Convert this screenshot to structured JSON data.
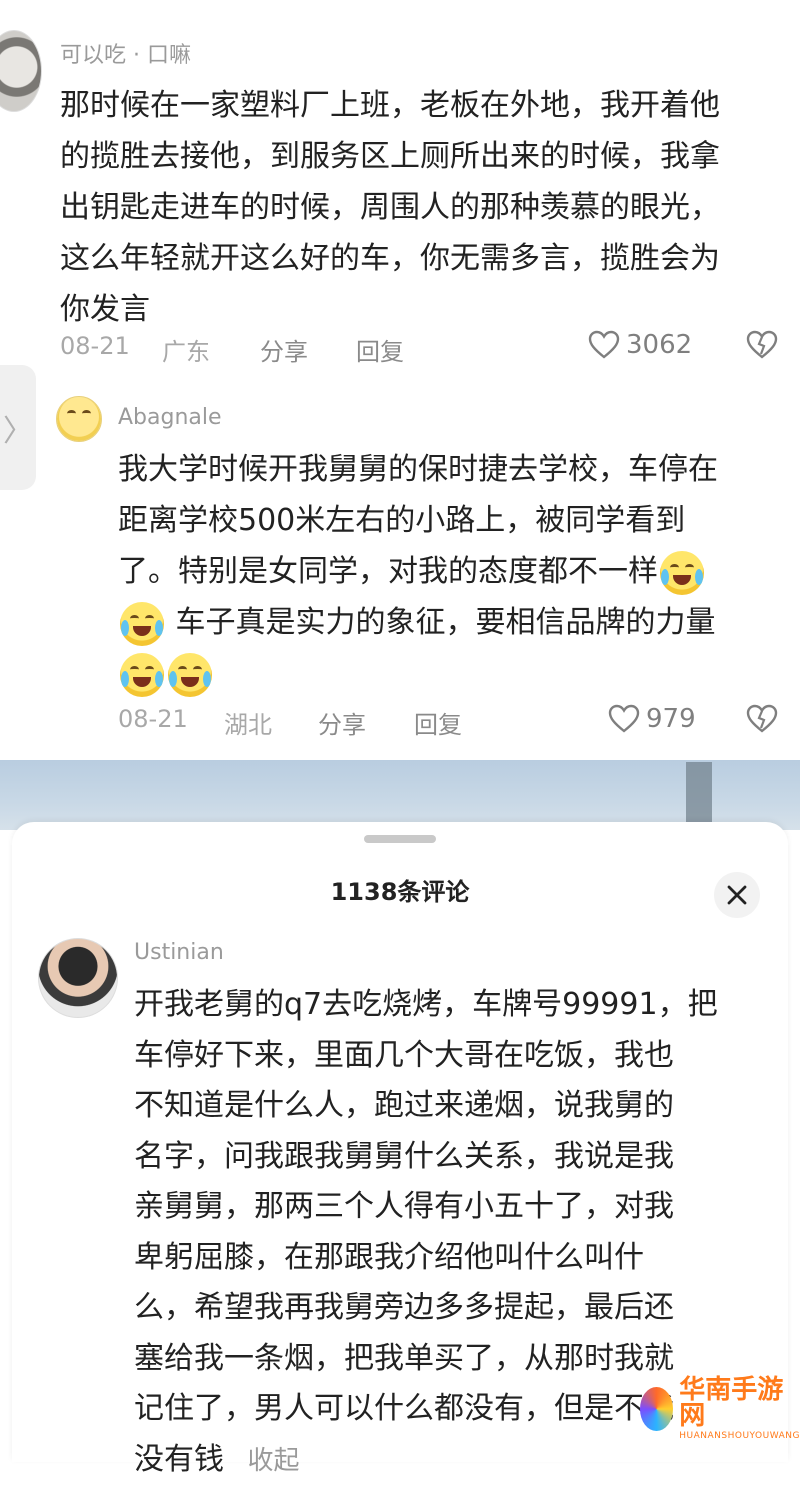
{
  "comments": [
    {
      "username": "可以吃 · 口嘛",
      "text_lines": [
        "那时候在一家塑料厂上班，老板在外地，我开着他",
        "的揽胜去接他，到服务区上厕所出来的时候，我拿",
        "出钥匙走进车的时候，周围人的那种羡慕的眼光，",
        "这么年轻就开这么好的车，你无需多言，揽胜会为",
        "你发言"
      ],
      "date": "08-21",
      "location": "广东",
      "share_label": "分享",
      "reply_label": "回复",
      "likes": "3062"
    },
    {
      "username": "Abagnale",
      "text_lines": [
        "我大学时候开我舅舅的保时捷去学校，车停在",
        "距离学校500米左右的小路上，被同学看到",
        "了。特别是女同学，对我的态度都不一样",
        "车子真是实力的象征，要相信品牌的力量"
      ],
      "date": "08-21",
      "location": "湖北",
      "share_label": "分享",
      "reply_label": "回复",
      "likes": "979"
    }
  ],
  "side_tab": {
    "icon": "chevron-right-icon",
    "glyph": "〉"
  },
  "sheet": {
    "title": "1138条评论",
    "close_icon": "close-icon",
    "comment": {
      "username": "Ustinian",
      "text_lines": [
        "开我老舅的q7去吃烧烤，车牌号99991，把",
        "车停好下来，里面几个大哥在吃饭，我也",
        "不知道是什么人，跑过来递烟，说我舅的",
        "名字，问我跟我舅舅什么关系，我说是我",
        "亲舅舅，那两三个人得有小五十了，对我",
        "卑躬屈膝，在那跟我介绍他叫什么叫什",
        "么，希望我再我舅旁边多多提起，最后还",
        "塞给我一条烟，把我单买了，从那时我就",
        "记住了，男人可以什么都没有，但是不能",
        "没有钱"
      ],
      "collapse_label": "收起"
    }
  },
  "watermark": {
    "cn": "华南手游网",
    "en": "HUANANSHOUYOUWANG"
  },
  "colors": {
    "text": "#222222",
    "meta": "#a8a8a8",
    "like_icon": "#7f7f7f"
  }
}
